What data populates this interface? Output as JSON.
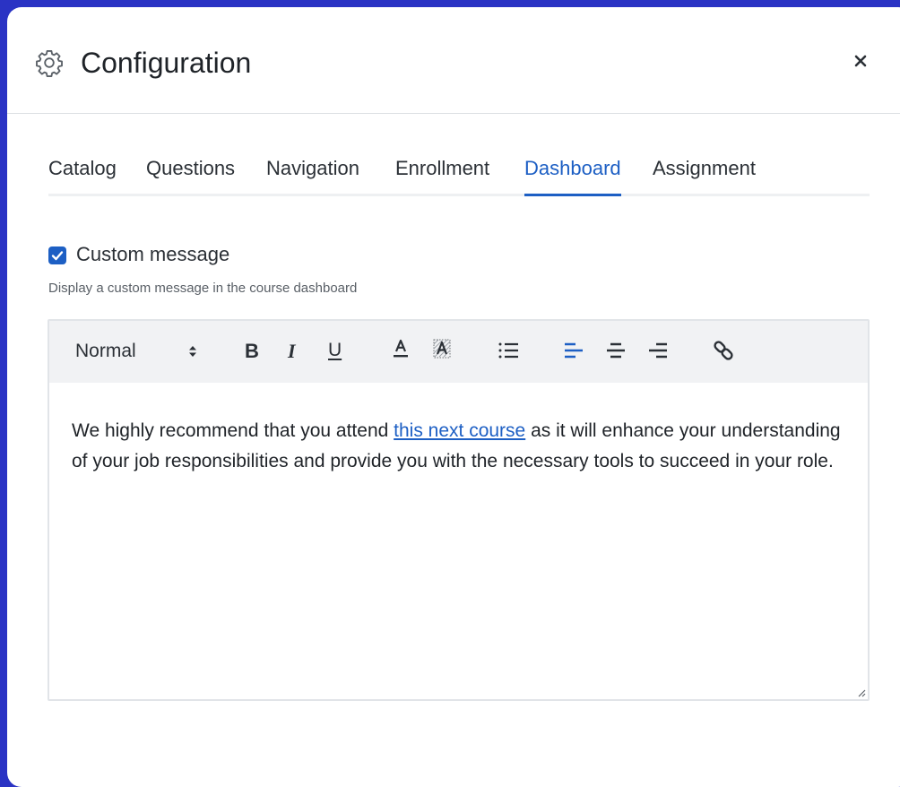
{
  "dialog": {
    "title": "Configuration",
    "header_icon": "gear-icon",
    "close_icon": "close-icon"
  },
  "tabs": [
    {
      "label": "Catalog",
      "active": false
    },
    {
      "label": "Questions",
      "active": false
    },
    {
      "label": "Navigation",
      "active": false
    },
    {
      "label": "Enrollment",
      "active": false
    },
    {
      "label": "Dashboard",
      "active": true
    },
    {
      "label": "Assignment",
      "active": false
    }
  ],
  "custom_message": {
    "checked": true,
    "label": "Custom message",
    "helper": "Display a custom message in the course dashboard"
  },
  "editor": {
    "toolbar": {
      "format_value": "Normal",
      "format_icon": "up-down-arrows-icon",
      "bold_label": "B",
      "italic_label": "I",
      "underline_label": "U",
      "font_color_icon": "font-color-icon",
      "highlight_icon": "highlight-color-icon",
      "bullet_list_icon": "bullet-list-icon",
      "align_left_icon": "align-left-icon",
      "align_center_icon": "align-center-icon",
      "align_right_icon": "align-right-icon",
      "link_icon": "link-icon",
      "active_align": "left"
    },
    "content": {
      "before_link": "We highly recommend that you attend ",
      "link_text": "this next course",
      "after_link": " as it will enhance your understanding of your job responsibilities and provide you with the necessary tools to succeed in your role."
    }
  },
  "colors": {
    "background": "#2a33c4",
    "accent": "#1d5fc4",
    "toolbar_bg": "#f1f2f4",
    "text": "#1f2328"
  }
}
